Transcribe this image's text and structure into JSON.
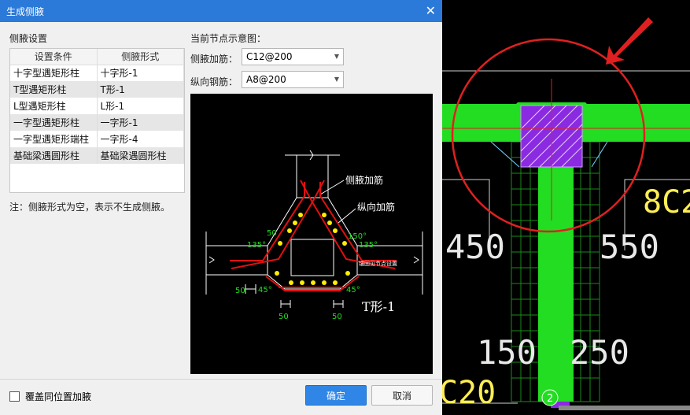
{
  "dialog": {
    "title": "生成侧腋",
    "close_glyph": "✕",
    "section_label": "侧腋设置",
    "table": {
      "headers": [
        "设置条件",
        "侧腋形式"
      ],
      "rows": [
        [
          "十字型遇矩形柱",
          "十字形-1"
        ],
        [
          "T型遇矩形柱",
          "T形-1"
        ],
        [
          "L型遇矩形柱",
          "L形-1"
        ],
        [
          "一字型遇矩形柱",
          "一字形-1"
        ],
        [
          "一字型遇矩形端柱",
          "一字形-4"
        ],
        [
          "基础梁遇圆形柱",
          "基础梁遇圆形柱"
        ]
      ]
    },
    "note": "注：侧腋形式为空，表示不生成侧腋。",
    "preview_label": "当前节点示意图：",
    "haunch_rebar_label": "侧腋加筋：",
    "haunch_rebar_value": "C12@200",
    "long_rebar_label": "纵向钢筋：",
    "long_rebar_value": "A8@200",
    "cover_label": "覆盖同位置加腋",
    "ok_label": "确定",
    "cancel_label": "取消"
  },
  "diagram": {
    "callout_haunch": "侧腋加筋",
    "callout_long": "纵向加筋",
    "dim_50": "50",
    "angle_135": "135°",
    "angle_150": "150°",
    "angle_45": "45°",
    "anchor_note": "锚固见节点设置",
    "shape_name": "T形-1"
  },
  "cad": {
    "dim_450": "450",
    "dim_550": "550",
    "dim_150": "150",
    "dim_250": "250",
    "label_c2": "8C2",
    "label_c20": "C20",
    "axis_no": "2"
  },
  "colors": {
    "title_bar": "#2b79d8",
    "ok_button": "#2f86e6",
    "beam_green": "#22dd22",
    "column_purple": "#8a2be2",
    "highlight_red": "#e02020"
  }
}
